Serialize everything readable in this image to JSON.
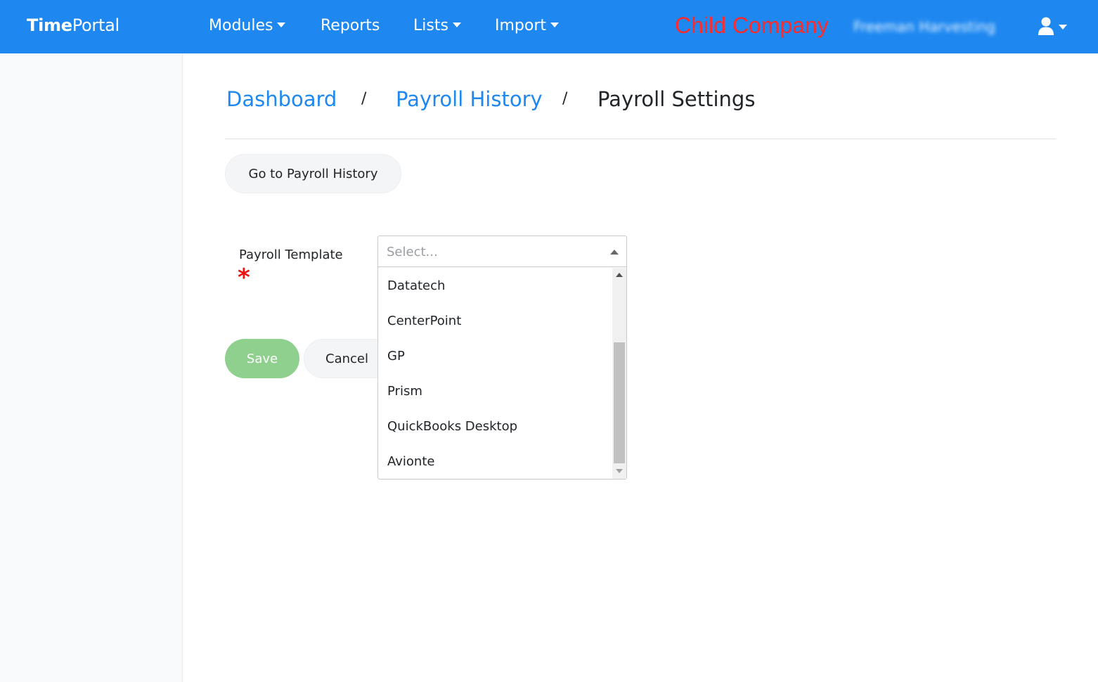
{
  "brand": {
    "part1": "Time",
    "part2": "Portal"
  },
  "nav": {
    "modules": "Modules",
    "reports": "Reports",
    "lists": "Lists",
    "import": "Import"
  },
  "header": {
    "child_company": "Child Company",
    "company_name": "Freeman Harvesting",
    "user_icon": "user-icon"
  },
  "breadcrumb": {
    "dashboard": "Dashboard",
    "separator": "/",
    "payroll_history": "Payroll History",
    "current": "Payroll Settings"
  },
  "actions": {
    "go_to_history": "Go to Payroll History",
    "save": "Save",
    "cancel": "Cancel"
  },
  "form": {
    "template_label": "Payroll Template",
    "required_mark": "*",
    "template_placeholder": "Select...",
    "template_value": "",
    "options": [
      "Datatech",
      "CenterPoint",
      "GP",
      "Prism",
      "QuickBooks Desktop",
      "Avionte"
    ]
  },
  "colors": {
    "primary": "#1e88f0",
    "save_button": "#8fd08f",
    "required": "#ee1111",
    "child_company_text": "#ff2a2a"
  }
}
